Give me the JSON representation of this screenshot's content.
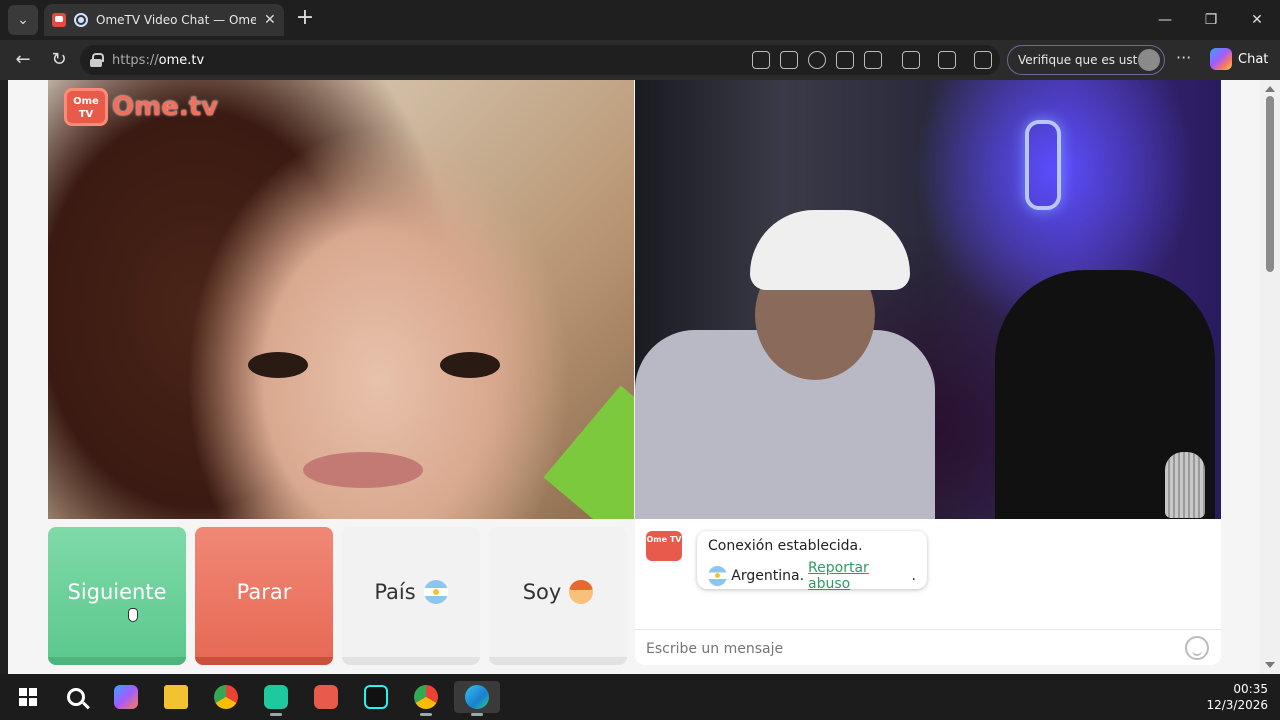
{
  "browser": {
    "tab_title": "OmeTV Video Chat — Omegle",
    "tab_close": "✕",
    "new_tab": "+",
    "url_protocol": "https://",
    "url_host": "ome.tv",
    "verify_label": "Verifique que es usted",
    "more": "···",
    "chat_label": "Chat",
    "window_controls": [
      "—",
      "❐",
      "✕"
    ]
  },
  "logo": {
    "badge_text": "Ome TV",
    "text": "Ome.tv"
  },
  "controls": {
    "next_label": "Siguiente",
    "stop_label": "Parar",
    "country_label": "País",
    "gender_label": "Soy"
  },
  "chat": {
    "avatar_text": "Ome TV",
    "status_line": "Conexión establecida.",
    "country": "Argentina.",
    "report_link": "Reportar abuso",
    "trailing": ".",
    "input_placeholder": "Escribe un mensaje"
  },
  "taskbar": {
    "time": "00:35",
    "date": "12/3/2026",
    "apps": [
      "start-icon",
      "search-icon",
      "copilot-icon",
      "file-explorer-icon",
      "chrome-icon",
      "app-icon",
      "ometv-icon",
      "tiktok-icon",
      "chrome-profile-icon",
      "edge-icon"
    ]
  },
  "colors": {
    "next_button": "#5cc98e",
    "stop_button": "#e76a55",
    "brand": "#e85a4a",
    "link": "#2e9b62"
  }
}
